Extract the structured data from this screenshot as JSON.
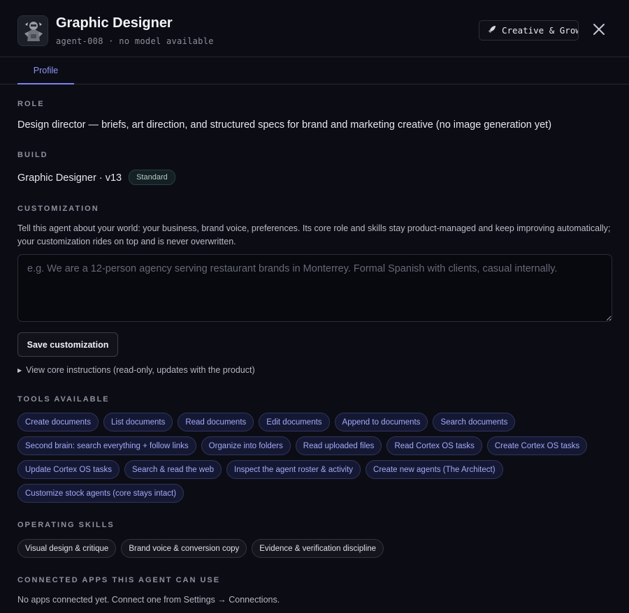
{
  "agent": {
    "name": "Graphic Designer",
    "meta": "agent-008 · no model available",
    "team_badge": "Creative & Growth",
    "team_icon": "rocket-icon",
    "avatar_icon": "robot-avatar-icon"
  },
  "tabs": [
    {
      "label": "Profile",
      "active": true
    }
  ],
  "role": {
    "heading": "ROLE",
    "text": "Design director — briefs, art direction, and structured specs for brand and marketing creative (no image generation yet)"
  },
  "build": {
    "heading": "BUILD",
    "text": "Graphic Designer · v13",
    "tier": "Standard"
  },
  "customization": {
    "heading": "CUSTOMIZATION",
    "description": "Tell this agent about your world: your business, brand voice, preferences. Its core role and skills stay product-managed and keep improving automatically; your customization rides on top and is never overwritten.",
    "value": "",
    "placeholder": "e.g. We are a 12-person agency serving restaurant brands in Monterrey. Formal Spanish with clients, casual internally.",
    "save_label": "Save customization",
    "core_instructions_label": "View core instructions (read-only, updates with the product)"
  },
  "tools": {
    "heading": "TOOLS AVAILABLE",
    "items": [
      "Create documents",
      "List documents",
      "Read documents",
      "Edit documents",
      "Append to documents",
      "Search documents",
      "Second brain: search everything + follow links",
      "Organize into folders",
      "Read uploaded files",
      "Read Cortex OS tasks",
      "Create Cortex OS tasks",
      "Update Cortex OS tasks",
      "Search & read the web",
      "Inspect the agent roster & activity",
      "Create new agents (The Architect)",
      "Customize stock agents (core stays intact)"
    ]
  },
  "skills": {
    "heading": "OPERATING SKILLS",
    "items": [
      "Visual design & critique",
      "Brand voice & conversion copy",
      "Evidence & verification discipline"
    ]
  },
  "connected_apps": {
    "heading": "CONNECTED APPS THIS AGENT CAN USE",
    "text": "No apps connected yet. Connect one from Settings → Connections."
  },
  "colors": {
    "background": "#0c0d14",
    "accent": "#7c83f0",
    "tool_chip_text": "#a3aaf7"
  }
}
